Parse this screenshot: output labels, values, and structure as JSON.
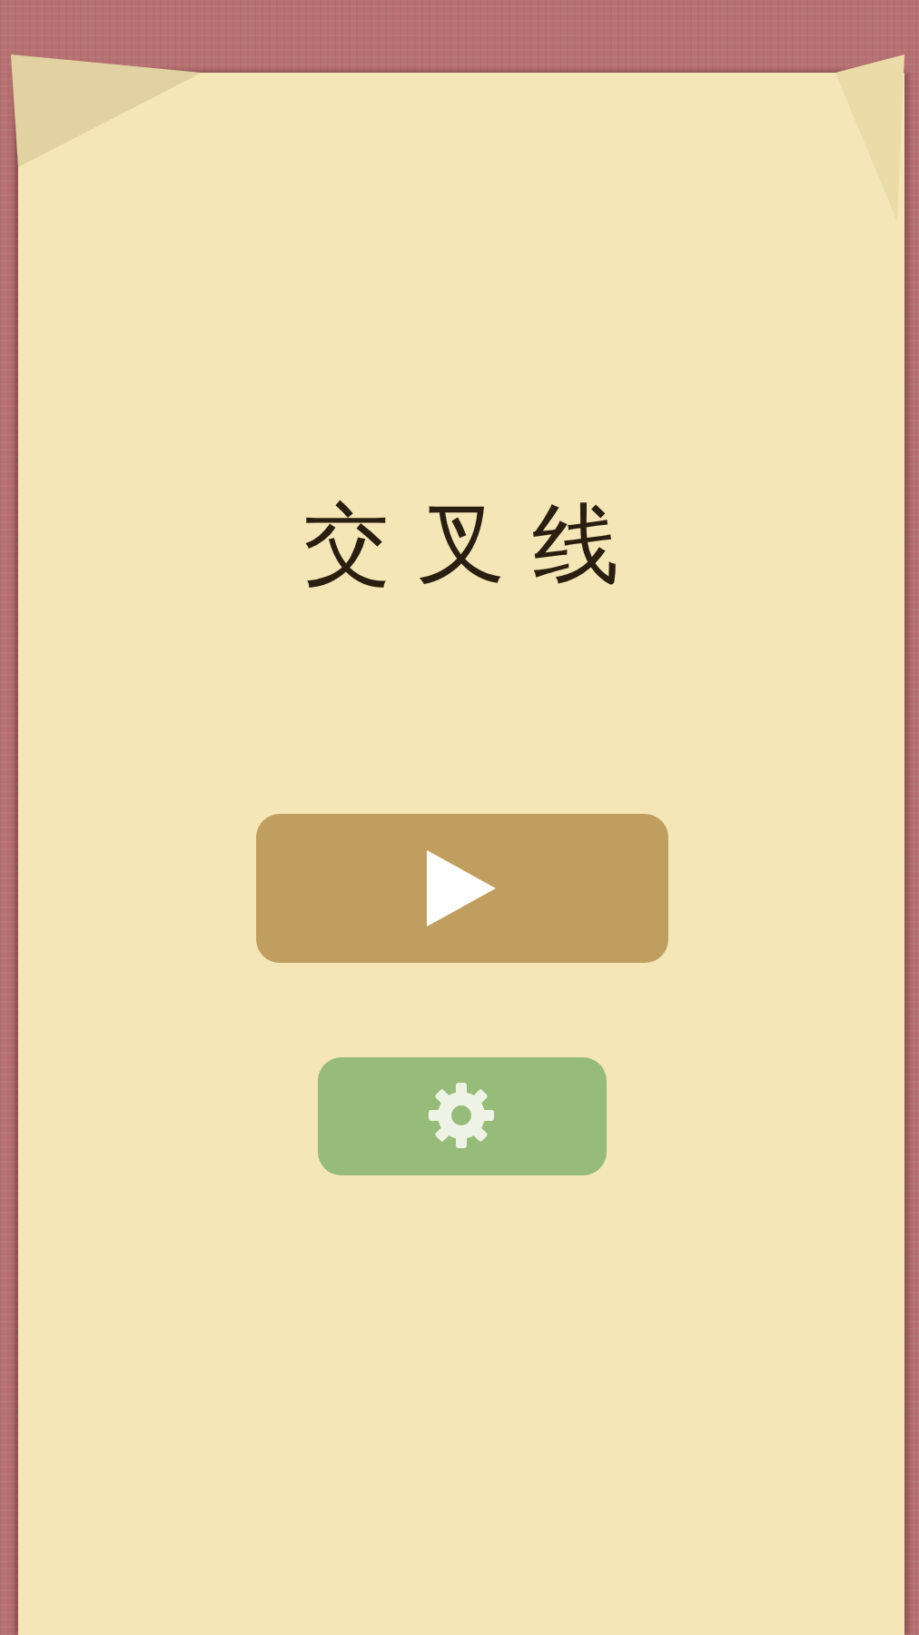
{
  "title": "交叉线",
  "buttons": [
    {
      "kind": "play"
    },
    {
      "kind": "settings"
    }
  ]
}
